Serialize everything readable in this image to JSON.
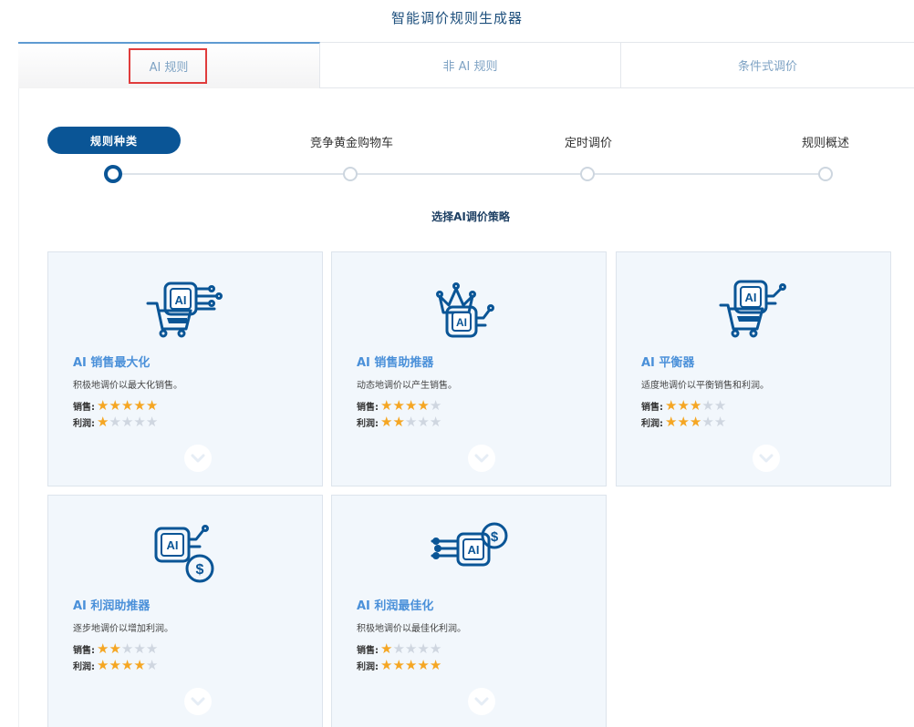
{
  "page": {
    "title": "智能调价规则生成器"
  },
  "tabs": [
    {
      "label": "AI 规则"
    },
    {
      "label": "非 AI 规则"
    },
    {
      "label": "条件式调价"
    }
  ],
  "steps": [
    {
      "label": "规则种类",
      "active": true
    },
    {
      "label": "竞争黄金购物车"
    },
    {
      "label": "定时调价"
    },
    {
      "label": "规则概述"
    }
  ],
  "section": {
    "title": "选择AI调价策略"
  },
  "rating_labels": {
    "sales": "销售:",
    "profit": "利润:"
  },
  "colors": {
    "accent": "#0a5596",
    "link": "#4a90d9",
    "star": "#f5a623",
    "highlight": "#e03c3c"
  },
  "cards": [
    {
      "title": "AI 销售最大化",
      "desc": "积极地调价以最大化销售。",
      "sales": 5,
      "profit": 1,
      "icon": "ai-chip-cart-circuit-icon"
    },
    {
      "title": "AI 销售助推器",
      "desc": "动态地调价以产生销售。",
      "sales": 4,
      "profit": 2,
      "icon": "ai-chip-crown-icon"
    },
    {
      "title": "AI 平衡器",
      "desc": "适度地调价以平衡销售和利润。",
      "sales": 3,
      "profit": 3,
      "icon": "ai-chip-cart-icon"
    },
    {
      "title": "AI 利润助推器",
      "desc": "逐步地调价以增加利润。",
      "sales": 2,
      "profit": 4,
      "icon": "ai-chip-dollar-icon"
    },
    {
      "title": "AI 利润最佳化",
      "desc": "积极地调价以最佳化利润。",
      "sales": 1,
      "profit": 5,
      "icon": "ai-chip-circuit-dollar-icon"
    }
  ]
}
